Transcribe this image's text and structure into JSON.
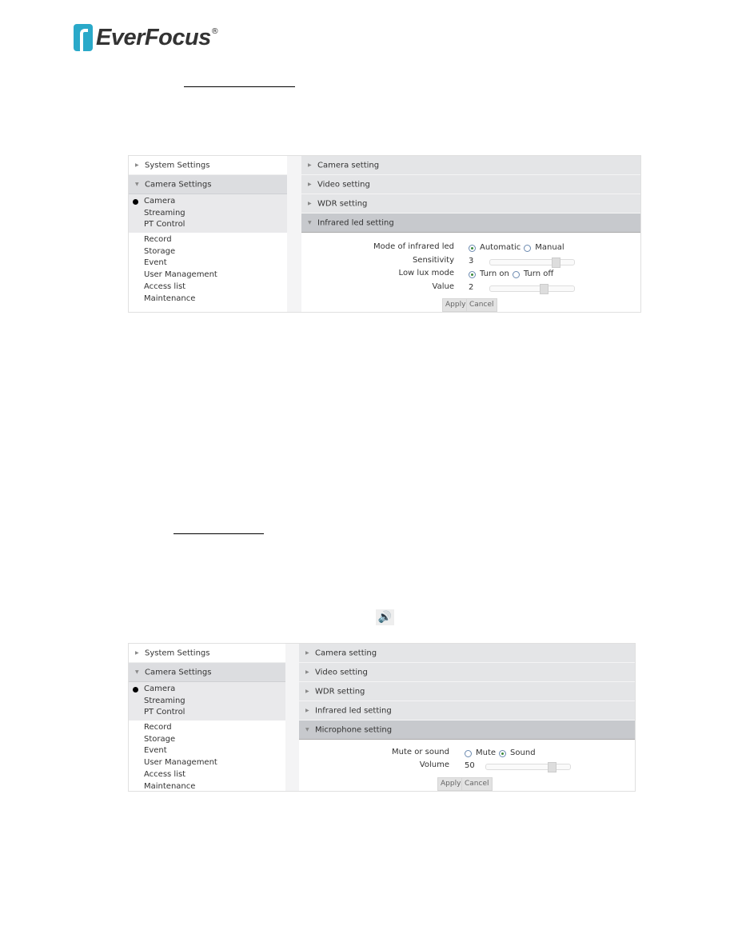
{
  "logo": {
    "text": "EverFocus",
    "reg": "®"
  },
  "speaker_icon": "speaker-volume-icon",
  "panels": [
    {
      "sidebar": {
        "headers": [
          "System Settings",
          "Camera Settings"
        ],
        "sub_items": [
          "Camera",
          "Streaming",
          "PT Control"
        ],
        "items": [
          "Record",
          "Storage",
          "Event",
          "User Management",
          "Access list",
          "Maintenance"
        ],
        "selected": "Camera"
      },
      "sections": [
        "Camera setting",
        "Video setting",
        "WDR setting",
        "Infrared led setting"
      ],
      "expanded": "Infrared led setting",
      "fields": [
        {
          "label": "Mode of infrared led",
          "type": "radio",
          "options": [
            "Automatic",
            "Manual"
          ],
          "selected": "Automatic"
        },
        {
          "label": "Sensitivity",
          "type": "slider",
          "value": "3",
          "fraction": 0.8
        },
        {
          "label": "Low lux mode",
          "type": "radio",
          "options": [
            "Turn on",
            "Turn off"
          ],
          "selected": "Turn on"
        },
        {
          "label": "Value",
          "type": "slider",
          "value": "2",
          "fraction": 0.65
        }
      ],
      "apply": "Apply",
      "cancel": "Cancel"
    },
    {
      "sidebar": {
        "headers": [
          "System Settings",
          "Camera Settings"
        ],
        "sub_items": [
          "Camera",
          "Streaming",
          "PT Control"
        ],
        "items": [
          "Record",
          "Storage",
          "Event",
          "User Management",
          "Access list",
          "Maintenance"
        ],
        "selected": "Camera"
      },
      "sections": [
        "Camera setting",
        "Video setting",
        "WDR setting",
        "Infrared led setting",
        "Microphone setting"
      ],
      "expanded": "Microphone setting",
      "fields": [
        {
          "label": "Mute or sound",
          "type": "radio",
          "options": [
            "Mute",
            "Sound"
          ],
          "selected": "Sound"
        },
        {
          "label": "Volume",
          "type": "slider",
          "value": "50",
          "fraction": 0.8
        }
      ],
      "apply": "Apply",
      "cancel": "Cancel"
    }
  ]
}
